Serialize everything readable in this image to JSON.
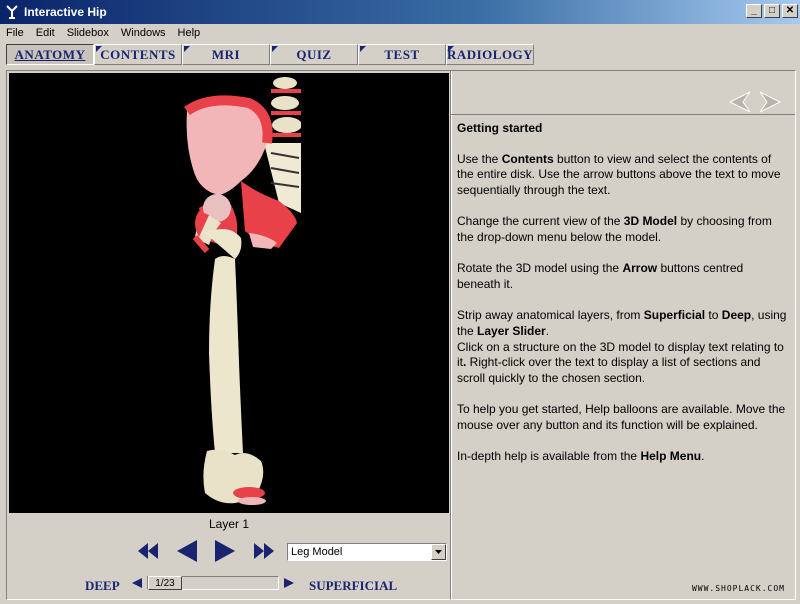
{
  "window": {
    "title": "Interactive Hip",
    "controls": [
      "_",
      "□",
      "✕"
    ]
  },
  "menu": [
    "File",
    "Edit",
    "Slidebox",
    "Windows",
    "Help"
  ],
  "tabs": [
    "ANATOMY",
    "CONTENTS",
    "MRI",
    "QUIZ",
    "TEST",
    "RADIOLOGY"
  ],
  "active_tab": "ANATOMY",
  "viewer": {
    "layer_label": "Layer 1",
    "model_select": "Leg Model"
  },
  "slider": {
    "deep_label": "DEEP",
    "superficial_label": "SUPERFICIAL",
    "position": "1/23"
  },
  "help": {
    "heading": "Getting started",
    "p1_a": "Use the ",
    "p1_b": "Contents",
    "p1_c": " button to view and select the contents of the entire disk.  Use the arrow buttons above the text to move sequentially through the text.",
    "p2_a": "Change the current view of the ",
    "p2_b": "3D Model",
    "p2_c": " by choosing from the drop-down menu below the model.",
    "p3_a": "Rotate the 3D model using the ",
    "p3_b": "Arrow",
    "p3_c": " buttons centred beneath it.",
    "p4_a": "Strip away anatomical layers, from ",
    "p4_b": "Superficial",
    "p4_c": " to ",
    "p4_d": "Deep",
    "p4_e": ", using the ",
    "p4_f": "Layer Slider",
    "p4_g": ".",
    "p4_h": "Click on a structure on the 3D model to display text relating to it",
    "p4_i": ".",
    "p4_j": " Right-click over the text to display a list of sections and scroll quickly to the chosen section.",
    "p5": "To help you get started, Help balloons are available. Move the mouse over any button and its function will be explained.",
    "p6_a": "In-depth help is available from the ",
    "p6_b": "Help Menu",
    "p6_c": "."
  },
  "watermark": "WWW.SHOPLACK.COM",
  "colors": {
    "nav_blue": "#1a2370",
    "bone": "#ece6cc",
    "muscle": "#e8414a",
    "viewer_bg": "#000000"
  }
}
